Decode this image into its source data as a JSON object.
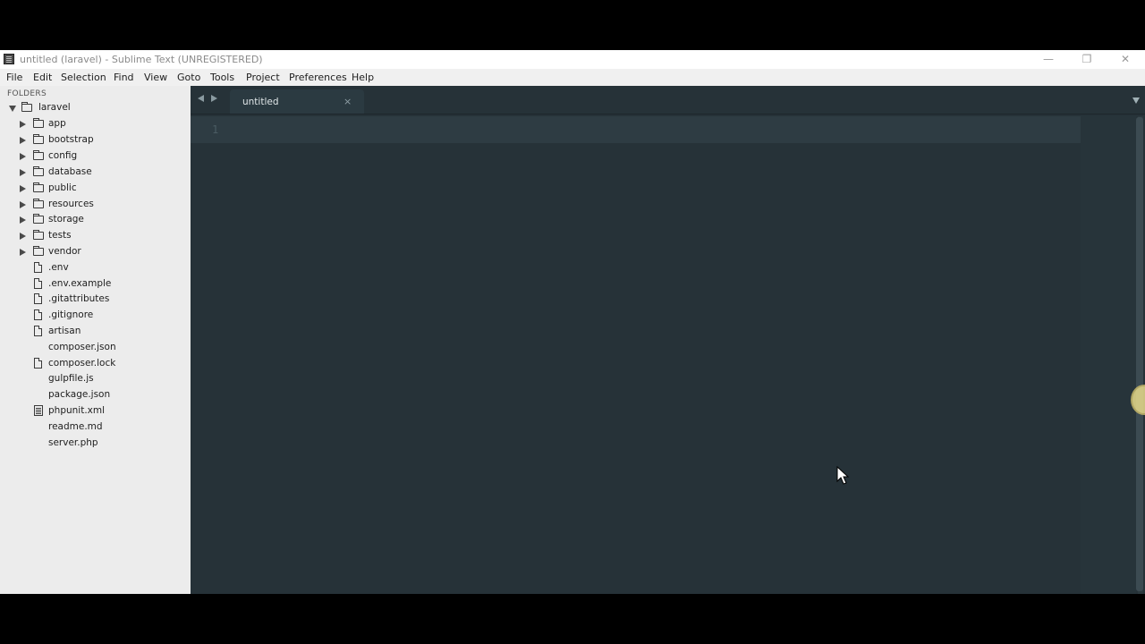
{
  "window": {
    "title": "untitled (laravel) - Sublime Text (UNREGISTERED)",
    "controls": {
      "minimize": "—",
      "maximize": "❐",
      "close": "✕"
    }
  },
  "menu": [
    "File",
    "Edit",
    "Selection",
    "Find",
    "View",
    "Goto",
    "Tools",
    "Project",
    "Preferences",
    "Help"
  ],
  "sidebar": {
    "heading": "FOLDERS",
    "root": {
      "label": "laravel",
      "expanded": true
    },
    "items": [
      {
        "label": "app",
        "type": "folder"
      },
      {
        "label": "bootstrap",
        "type": "folder"
      },
      {
        "label": "config",
        "type": "folder"
      },
      {
        "label": "database",
        "type": "folder"
      },
      {
        "label": "public",
        "type": "folder"
      },
      {
        "label": "resources",
        "type": "folder"
      },
      {
        "label": "storage",
        "type": "folder"
      },
      {
        "label": "tests",
        "type": "folder"
      },
      {
        "label": "vendor",
        "type": "folder"
      },
      {
        "label": ".env",
        "type": "file"
      },
      {
        "label": ".env.example",
        "type": "file"
      },
      {
        "label": ".gitattributes",
        "type": "file"
      },
      {
        "label": ".gitignore",
        "type": "file"
      },
      {
        "label": "artisan",
        "type": "file"
      },
      {
        "label": "composer.json",
        "type": "plain"
      },
      {
        "label": "composer.lock",
        "type": "file"
      },
      {
        "label": "gulpfile.js",
        "type": "plain"
      },
      {
        "label": "package.json",
        "type": "plain"
      },
      {
        "label": "phpunit.xml",
        "type": "xml"
      },
      {
        "label": "readme.md",
        "type": "plain"
      },
      {
        "label": "server.php",
        "type": "plain"
      }
    ]
  },
  "editor": {
    "tabs": [
      {
        "label": "untitled",
        "close": "×"
      }
    ],
    "line_numbers": [
      "1"
    ]
  },
  "colors": {
    "editor_bg": "#263238",
    "sidebar_bg": "#ececec",
    "tab_bg": "#2b3a41"
  }
}
